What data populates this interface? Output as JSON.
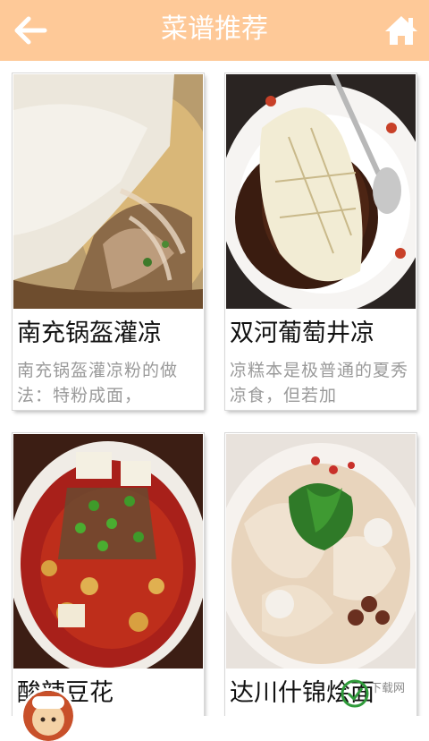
{
  "header": {
    "title": "菜谱推荐",
    "background": "#fec998",
    "back_icon": "arrow-left",
    "home_icon": "house"
  },
  "recipes": [
    {
      "name": "南充锅盔灌凉",
      "desc": "南充锅盔灌凉粉的做法：特粉成面，"
    },
    {
      "name": "双河葡萄井凉",
      "desc": "凉糕本是极普通的夏秀凉食，但若加"
    },
    {
      "name": "酸辣豆花",
      "desc": ""
    },
    {
      "name": "达川什锦烩面",
      "desc": ""
    }
  ],
  "watermark": {
    "text": "下载网"
  }
}
